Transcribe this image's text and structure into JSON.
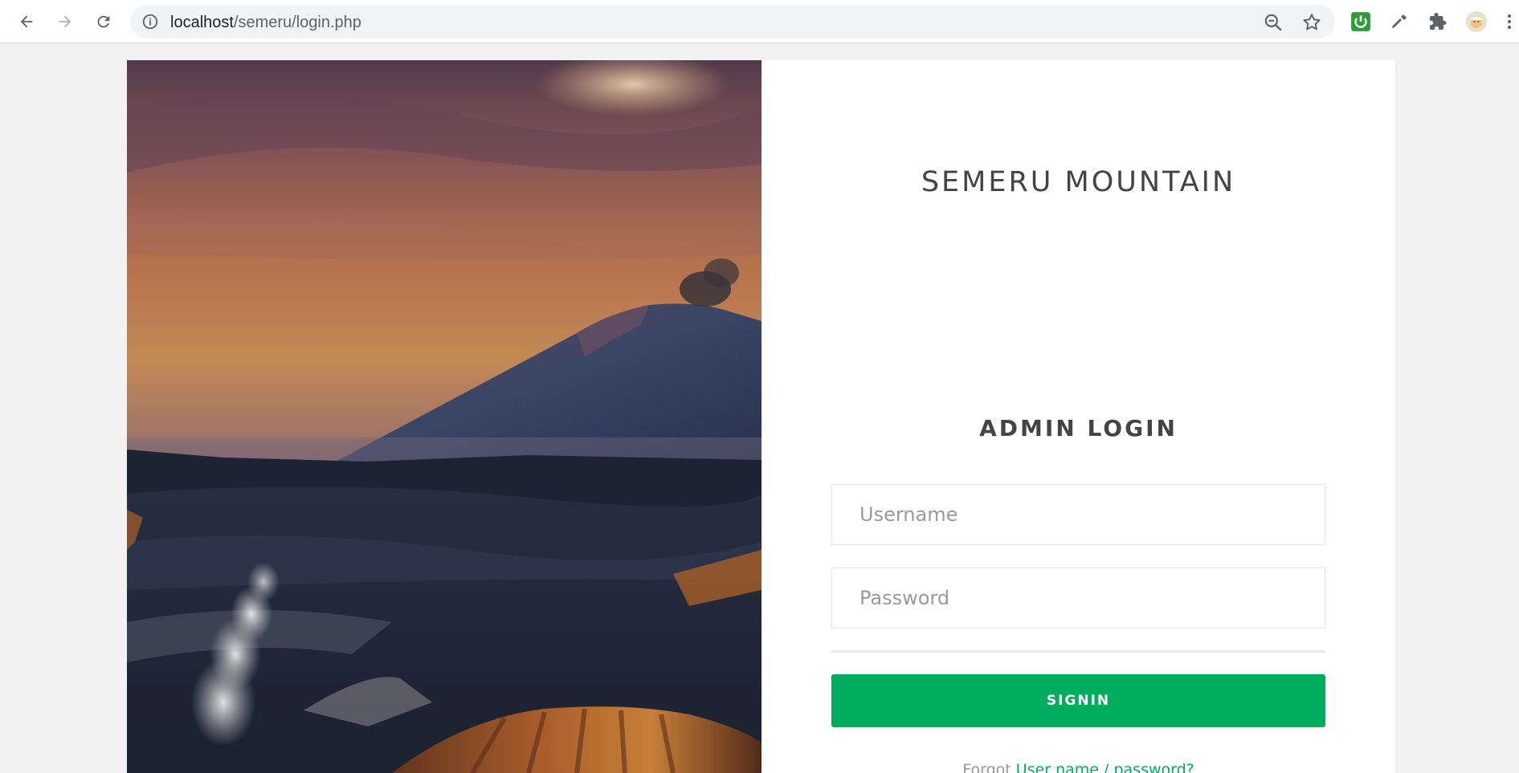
{
  "browser": {
    "url_host": "localhost",
    "url_path": "/semeru/login.php",
    "icons": {
      "back": "arrow-left-icon",
      "forward": "arrow-right-icon",
      "reload": "reload-icon",
      "info": "info-icon",
      "zoom": "zoom-out-icon",
      "bookmark": "star-icon",
      "extensions": [
        "power-extension-icon",
        "eyedropper-icon",
        "puzzle-icon",
        "profile-avatar",
        "kebab-menu-icon"
      ]
    }
  },
  "hero": {
    "description_icon": "volcano-landscape-image"
  },
  "login": {
    "site_title": "SEMERU MOUNTAIN",
    "form_title": "ADMIN LOGIN",
    "username_placeholder": "Username",
    "password_placeholder": "Password",
    "signin_label": "SIGNIN",
    "forgot_prefix": "Forgot ",
    "forgot_link": "User name / password?"
  },
  "colors": {
    "accent": "#00ad5f",
    "title_text": "#444444",
    "page_bg": "#f2f2f2"
  }
}
